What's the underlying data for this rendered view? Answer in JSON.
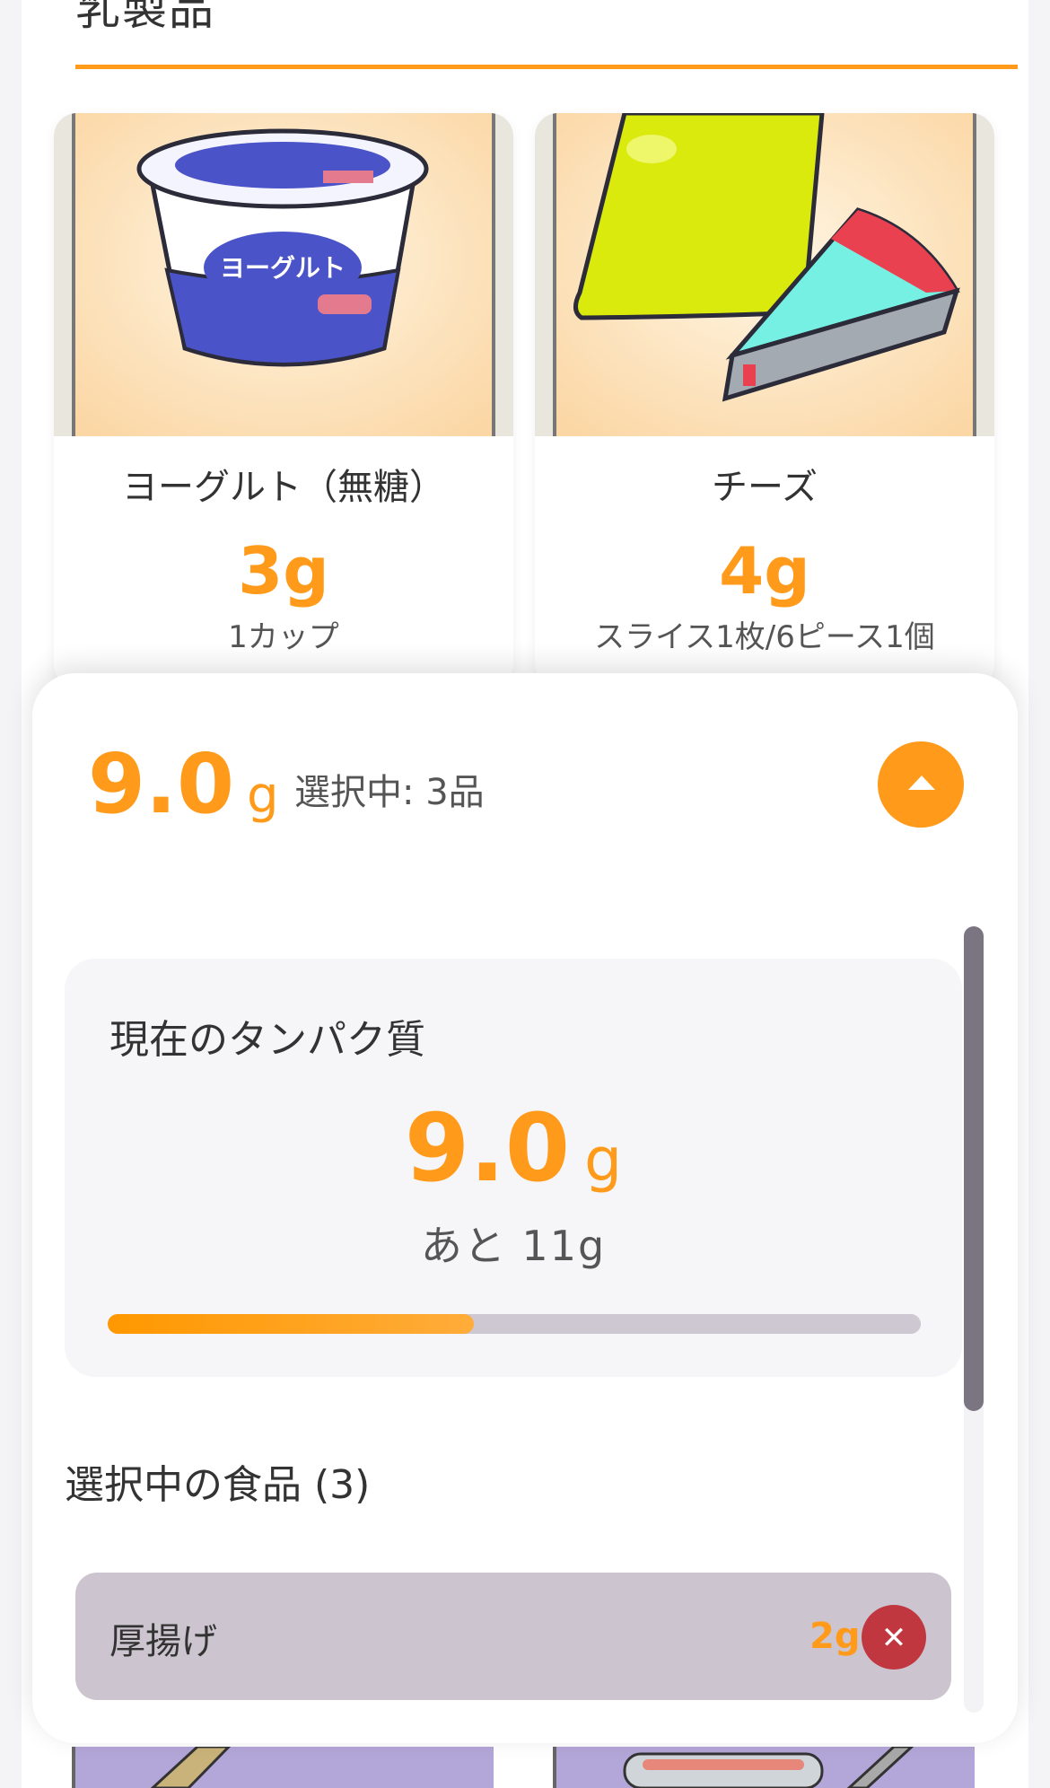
{
  "section": {
    "title": "乳製品"
  },
  "foods": [
    {
      "name": "ヨーグルト（無糖）",
      "protein": "3g",
      "portion": "1カップ",
      "image": "yogurt-cup",
      "label": "ヨーグルト"
    },
    {
      "name": "チーズ",
      "protein": "4g",
      "portion": "スライス1枚/6ピース1個",
      "image": "cheese"
    }
  ],
  "sheet": {
    "total_value": "9.0",
    "total_unit": "g",
    "selected_count_label": "選択中: 3品",
    "collapse_icon": "triangle-up-icon",
    "panel": {
      "title": "現在のタンパク質",
      "value": "9.0",
      "unit": "g",
      "remaining": "あと 11g",
      "progress_percent": 45
    },
    "selected_title": "選択中の食品 (3)",
    "selected_items": [
      {
        "name": "厚揚げ",
        "protein": "2g",
        "remove_icon": "close-icon"
      }
    ]
  },
  "colors": {
    "accent": "#ff9a1a",
    "remove": "#c0373f",
    "item_bg": "#ccc5cf"
  }
}
